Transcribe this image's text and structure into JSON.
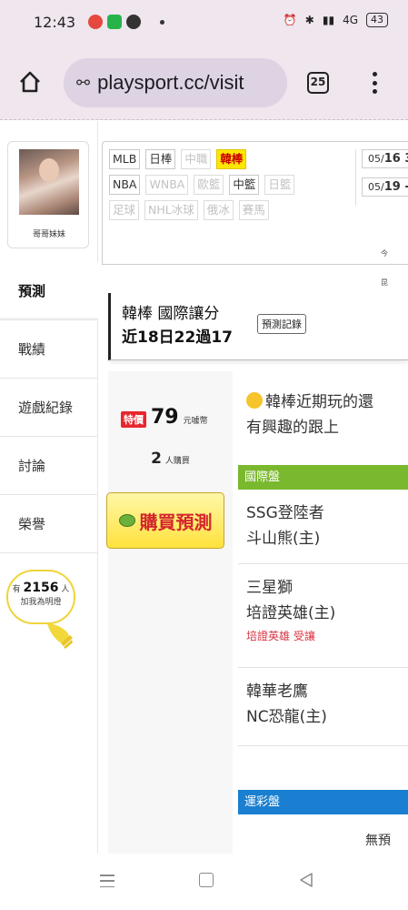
{
  "status_bar": {
    "time": "12:43",
    "network": "4G",
    "battery": "43"
  },
  "browser": {
    "url": "playsport.cc/visit",
    "tab_count": "25"
  },
  "profile": {
    "name": "哥哥妹妹"
  },
  "side_menu": {
    "items": [
      "預測",
      "戰績",
      "遊戲紀錄",
      "討論",
      "榮譽"
    ],
    "fans_prefix": "有",
    "fans_count": "2156",
    "fans_suffix": "人",
    "fans_caption": "加我為明燈"
  },
  "sports_nav": {
    "row1": [
      "MLB",
      "日棒",
      "中職",
      "韓棒"
    ],
    "row2": [
      "NBA",
      "WNBA",
      "歐籃",
      "中籃",
      "日籃"
    ],
    "row3": [
      "足球",
      "NHL冰球",
      "俄冰",
      "賽馬"
    ],
    "dates": [
      {
        "month": "05/",
        "day": "16",
        "suffix": " 3"
      },
      {
        "month": "05/",
        "day": "19",
        "suffix": " -"
      }
    ],
    "side_note_1": "今",
    "side_note_2": "昆"
  },
  "prediction": {
    "title": "韓棒 國際讓分",
    "record_button": "預測記錄",
    "stats": "近18日22過17",
    "special_badge": "特價",
    "price": "79",
    "price_unit": "元噱幣",
    "buyers_count": "2",
    "buyers_unit": "人購買",
    "buy_button": "購買預測",
    "intro_line1": "韓棒近期玩的還",
    "intro_line2": "有興趣的跟上",
    "international_section": "國際盤",
    "sports_lottery_section": "運彩盤",
    "no_prediction": "無預",
    "matches": [
      {
        "away": "SSG登陸者",
        "home": "斗山熊(主)",
        "pick": ""
      },
      {
        "away": "三星獅",
        "home": "培證英雄(主)",
        "pick": "培證英雄 受讓"
      },
      {
        "away": "韓華老鷹",
        "home": "NC恐龍(主)",
        "pick": ""
      }
    ]
  }
}
